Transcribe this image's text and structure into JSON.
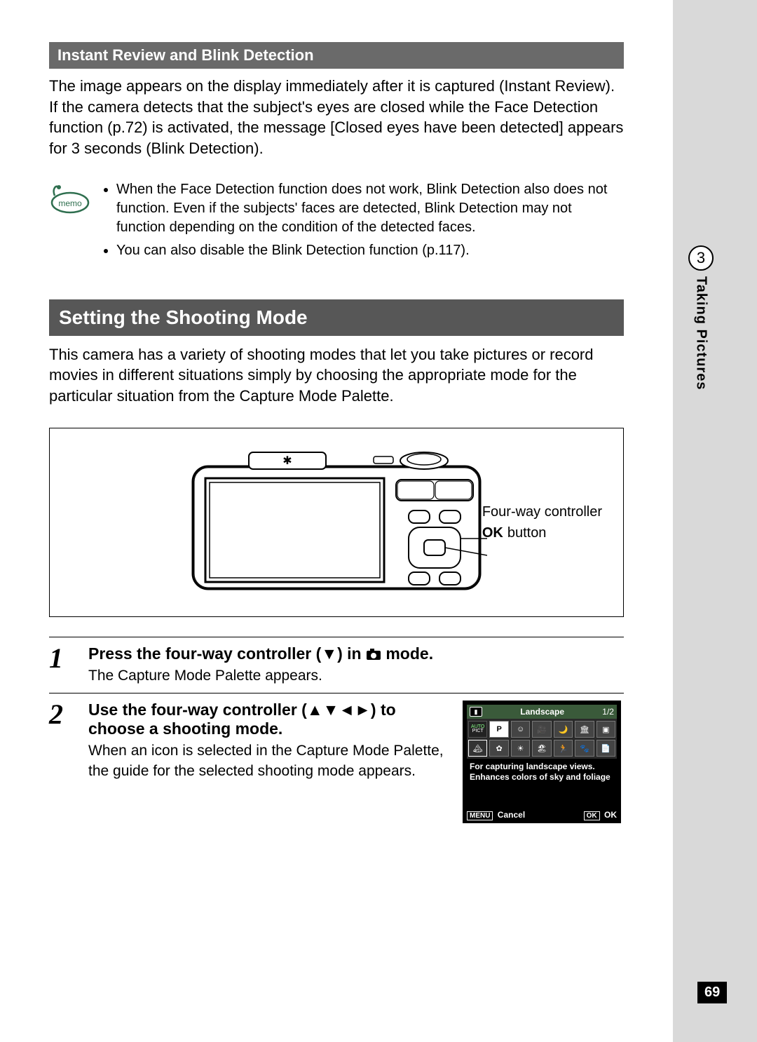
{
  "side": {
    "chapter_number": "3",
    "chapter_title": "Taking Pictures",
    "page_number": "69"
  },
  "section1": {
    "heading": "Instant Review and Blink Detection",
    "body": "The image appears on the display immediately after it is captured (Instant Review). If the camera detects that the subject's eyes are closed while the Face Detection function (p.72) is activated, the message [Closed eyes have been detected] appears for 3 seconds (Blink Detection)."
  },
  "memo": {
    "icon_label": "memo",
    "items": [
      "When the Face Detection function does not work, Blink Detection also does not function. Even if the subjects' faces are detected, Blink Detection may not function depending on the condition of the detected faces.",
      "You can also disable the Blink Detection function (p.117)."
    ]
  },
  "section2": {
    "heading": "Setting the Shooting Mode",
    "intro": "This camera has a variety of shooting modes that let you take pictures or record movies in different situations simply by choosing the appropriate mode for the particular situation from the Capture Mode Palette."
  },
  "diagram": {
    "callout1": "Four-way controller",
    "callout2_bold": "OK",
    "callout2_rest": " button"
  },
  "steps": {
    "s1": {
      "num": "1",
      "title_pre": "Press the four-way controller (",
      "title_arrow": "▼",
      "title_mid": ") in ",
      "title_post": " mode.",
      "desc": "The Capture Mode Palette appears."
    },
    "s2": {
      "num": "2",
      "title_pre": "Use the four-way controller (",
      "title_arrows": "▲▼◄►",
      "title_post": ") to choose a shooting mode.",
      "desc": "When an icon is selected in the Capture Mode Palette, the guide for the selected shooting mode appears."
    }
  },
  "lcd": {
    "top_title": "Landscape",
    "page": "1/2",
    "auto_top": "AUTO",
    "auto_bottom": "PICT",
    "p_label": "P",
    "desc": "For capturing landscape views. Enhances colors of sky and foliage",
    "menu_label": "MENU",
    "cancel": "Cancel",
    "ok_box": "OK",
    "ok_text": "OK"
  }
}
